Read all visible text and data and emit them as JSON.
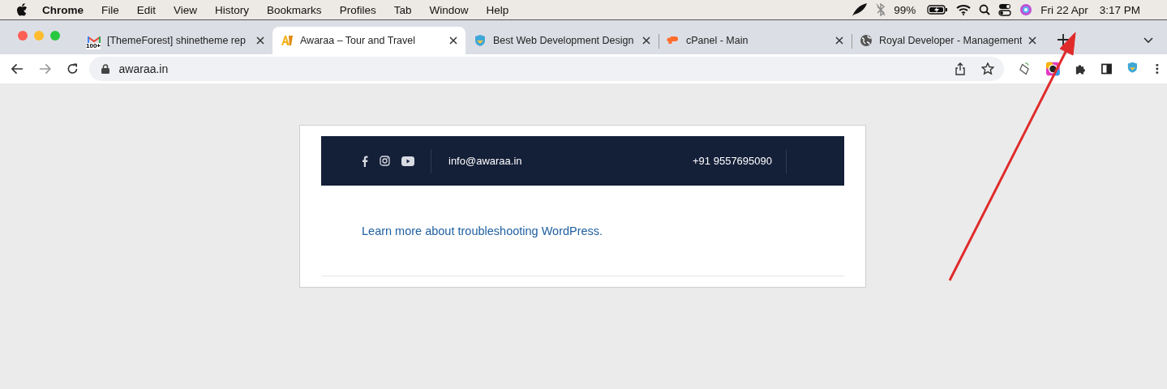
{
  "menubar": {
    "items": [
      {
        "label": "Chrome",
        "kind": "app"
      },
      {
        "label": "File",
        "kind": "menu"
      },
      {
        "label": "Edit",
        "kind": "menu"
      },
      {
        "label": "View",
        "kind": "menu"
      },
      {
        "label": "History",
        "kind": "menu"
      },
      {
        "label": "Bookmarks",
        "kind": "menu"
      },
      {
        "label": "Profiles",
        "kind": "menu"
      },
      {
        "label": "Tab",
        "kind": "menu"
      },
      {
        "label": "Window",
        "kind": "menu"
      },
      {
        "label": "Help",
        "kind": "menu"
      }
    ],
    "battery": "99%",
    "date": "Fri 22 Apr",
    "time": "3:17 PM"
  },
  "tabs": [
    {
      "title": "[ThemeForest] shinetheme rep",
      "selected": false,
      "kind": "mail",
      "badge": "100+"
    },
    {
      "title": "Awaraa – Tour and Travel",
      "selected": true,
      "kind": "logo"
    },
    {
      "title": "Best Web Development Design",
      "selected": false,
      "kind": "shield"
    },
    {
      "title": "cPanel - Main",
      "selected": false,
      "kind": "cpanel"
    },
    {
      "title": "Royal Developer - Management",
      "selected": false,
      "kind": "globe"
    }
  ],
  "address": "awaraa.in",
  "page": {
    "email": "info@awaraa.in",
    "phone": "+91 9557695090",
    "link": "Learn more about troubleshooting WordPress."
  }
}
